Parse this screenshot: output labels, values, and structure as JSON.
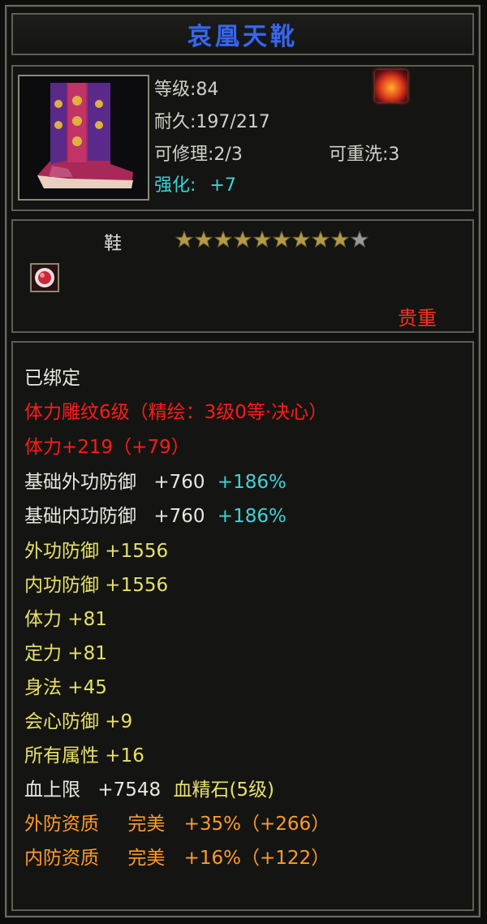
{
  "item": {
    "name": "哀凰天靴",
    "level": "等级:84",
    "durability": "耐久:197/217",
    "repairable": "可修理:2/3",
    "rewashable": "可重洗:3",
    "enhance_label": "强化:",
    "enhance_value": "+7",
    "type": "鞋",
    "star_count_filled": 9,
    "star_count_total": 10,
    "rarity": "贵重"
  },
  "stats": {
    "bound": "已绑定",
    "engrave_line": "体力雕纹6级（精绘：3级0等·决心）",
    "engrave_bonus": "体力+219（+79）",
    "base_ext_def_label": "基础外功防御",
    "base_ext_def_value": "+760",
    "base_ext_def_pct": "+186%",
    "base_int_def_label": "基础内功防御",
    "base_int_def_value": "+760",
    "base_int_def_pct": "+186%",
    "ext_def": "外功防御 +1556",
    "int_def": "内功防御 +1556",
    "stamina": "体力 +81",
    "focus": "定力 +81",
    "agility": "身法 +45",
    "crit_def": "会心防御 +9",
    "all_attr": "所有属性 +16",
    "hp_label": "血上限",
    "hp_value": "+7548",
    "hp_gem": "血精石(5级)",
    "ext_quality_label": "外防资质",
    "ext_quality_grade": "完美",
    "ext_quality_value": "+35%（+266）",
    "int_quality_label": "内防资质",
    "int_quality_grade": "完美",
    "int_quality_value": "+16%（+122）"
  },
  "colors": {
    "title": "#3a66e8",
    "enhance": "#38d6d6",
    "red": "#ff1a1a",
    "yellow": "#e8e06a",
    "cyan": "#3fd2d8",
    "orange": "#ff9a2a"
  },
  "icons": {
    "item": "boot-icon",
    "skill": "flame-icon",
    "gem": "gem-socket-icon",
    "star": "star-icon"
  }
}
